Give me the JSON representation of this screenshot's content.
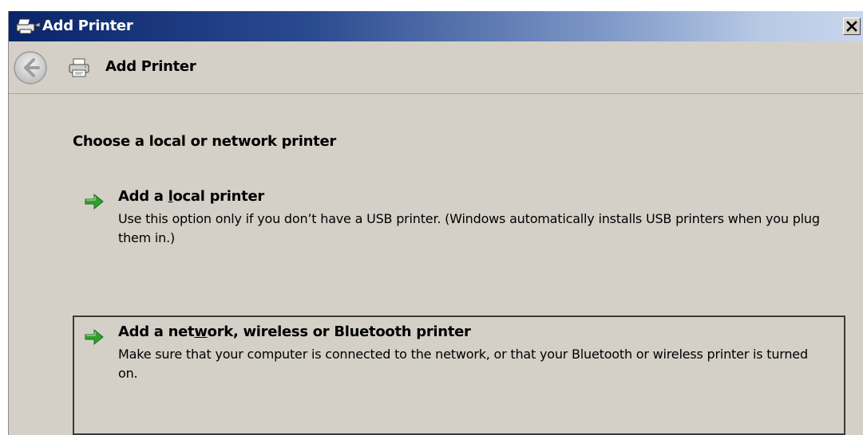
{
  "window": {
    "title": "Add Printer",
    "close_glyph": "X"
  },
  "header": {
    "title": "Add Printer",
    "back_icon": "back-arrow-icon",
    "printer_icon": "printer-icon"
  },
  "main": {
    "heading": "Choose a local or network printer",
    "options": [
      {
        "title_before": "Add a ",
        "title_accel": "l",
        "title_after": "ocal printer",
        "description": "Use this option only if you don’t have a USB printer. (Windows automatically installs USB printers when you plug them in.)",
        "icon": "green-arrow-icon",
        "selected": false
      },
      {
        "title_before": "Add a net",
        "title_accel": "w",
        "title_after": "ork, wireless or Bluetooth printer",
        "description": "Make sure that your computer is connected to the network, or that your Bluetooth or wireless printer is turned on.",
        "icon": "green-arrow-icon",
        "selected": true
      }
    ]
  },
  "colors": {
    "titlebar_start": "#0a246a",
    "titlebar_end": "#c8d6ec",
    "dialog_bg": "#d4d0c8",
    "arrow_green": "#2fa12f"
  }
}
